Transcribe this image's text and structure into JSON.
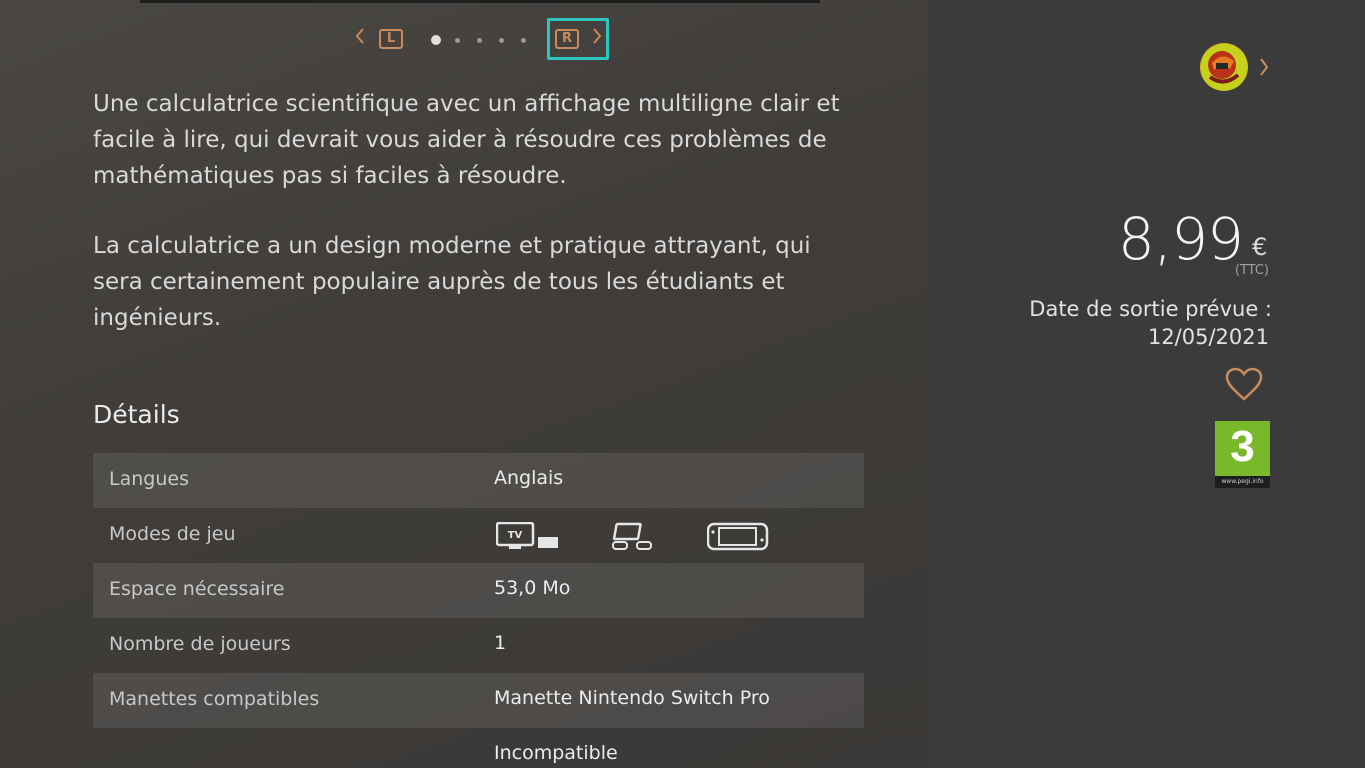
{
  "pager": {
    "left_bumper": "L",
    "right_bumper": "R",
    "page_count": 5,
    "current_page": 1
  },
  "description": {
    "paragraph1_lines": [
      "Une calculatrice scientifique avec un affichage multiligne clair et",
      "facile à lire, qui devrait vous aider à résoudre ces problèmes de",
      "mathématiques pas si faciles à résoudre."
    ],
    "paragraph2_lines": [
      "La calculatrice a un design moderne et pratique attrayant, qui",
      "sera certainement populaire auprès de tous les étudiants et",
      "ingénieurs."
    ]
  },
  "details": {
    "title": "Détails",
    "rows": [
      {
        "label": "Langues",
        "value": "Anglais"
      },
      {
        "label": "Modes de jeu",
        "value": "",
        "icons": [
          "tv-mode-icon",
          "tabletop-mode-icon",
          "handheld-mode-icon"
        ]
      },
      {
        "label": "Espace nécessaire",
        "value": "53,0 Mo"
      },
      {
        "label": "Nombre de joueurs",
        "value": "1"
      },
      {
        "label": "Manettes compatibles",
        "value": "Manette Nintendo Switch Pro"
      },
      {
        "label": "",
        "value": "Incompatible"
      }
    ],
    "tv_label": "TV"
  },
  "sidebar": {
    "price": "8,99",
    "currency": "€",
    "tax_note": "(TTC)",
    "release_label": "Date de sortie prévue :",
    "release_date": "12/05/2021",
    "rating": {
      "value": "3",
      "url": "www.pegi.info",
      "color": "#78b82a"
    }
  },
  "colors": {
    "accent": "#c98a5c",
    "focus": "#2ec7c0"
  }
}
